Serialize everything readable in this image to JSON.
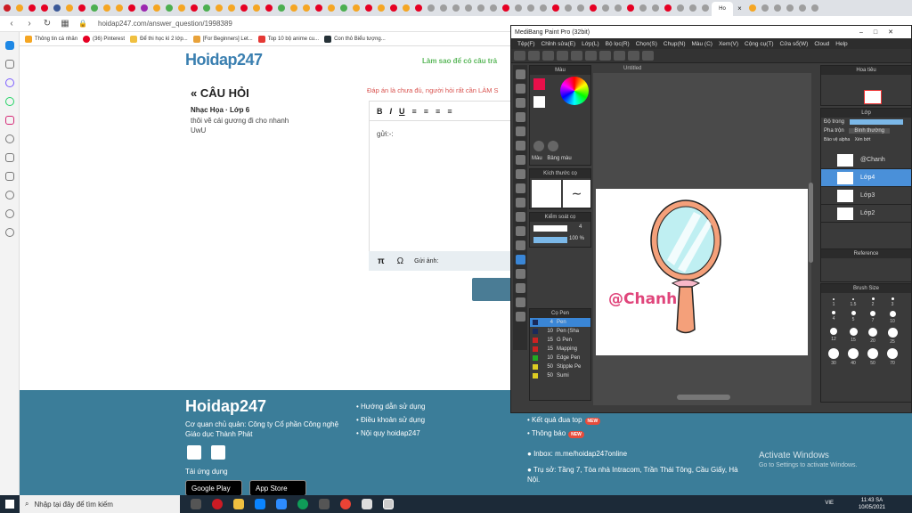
{
  "browser": {
    "url": "hoidap247.com/answer_question/1998389",
    "bookmarks": [
      "Thông tin cá nhân",
      "(36) Pinterest",
      "Để thi học kì 2 lớp...",
      "[For Beginners] Let...",
      "Top 10 bộ anime cu...",
      "Con thỏ Biểu tượng..."
    ],
    "active_tab": "Ho"
  },
  "page": {
    "logo": "Hoidap247",
    "how_ask": "Làm sao để có câu trả",
    "question_heading": "« CÂU HỎI",
    "subject": "Nhạc Họa · Lớp 6",
    "question_lines": [
      "thôi vẽ cái gương đi cho nhanh",
      "UwU"
    ],
    "warning": "Đáp án là chưa đủ, người hỏi rất cần LÀM S",
    "editor_text": "gửi:-:",
    "send_photo": "Gửi ảnh:"
  },
  "footer": {
    "logo": "Hoidap247",
    "company": "Cơ quan chủ quản: Công ty Cổ phần Công nghệ Giáo dục Thành Phát",
    "app_download": "Tải ứng dụng",
    "google_play": "Google Play",
    "app_store": "App Store",
    "links": [
      "Hướng dẫn sử dụng",
      "Điều khoản sử dụng",
      "Nội quy hoidap247"
    ],
    "results": "Kết quả đua top",
    "notice": "Thông báo",
    "new_badge": "NEW",
    "inbox": "Inbox: m.me/hoidap247online",
    "address": "Trụ sở: Tầng 7, Tòa nhà Intracom, Trần Thái Tông, Cầu Giấy, Hà Nội."
  },
  "windows": {
    "activate": "Activate Windows",
    "activate_sub": "Go to Settings to activate Windows.",
    "search_placeholder": "Nhập tại đây để tìm kiếm",
    "time": "11:43 SA",
    "date": "10/05/2021",
    "lang": "VIE"
  },
  "medibang": {
    "title": "MediBang Paint Pro (32bit)",
    "menu": [
      "Tệp(F)",
      "Chỉnh sửa(E)",
      "Lớp(L)",
      "Bộ lọc(R)",
      "Chọn(S)",
      "Chụp(N)",
      "Màu (C)",
      "Xem(V)",
      "Cộng cụ(T)",
      "Cửa sổ(W)",
      "Cloud",
      "Help"
    ],
    "panel_color": "Màu",
    "color_tabs": [
      "Màu",
      "Bảng màu"
    ],
    "panel_brushsize": "Kích thước cọ",
    "panel_brushcontrol": "Kiểm soát cọ",
    "brush_opacity": "100 %",
    "brush_value": "4",
    "panel_pen": "Cọ Pen",
    "pens": [
      {
        "size": "4",
        "name": "Pen",
        "color": "#1a2a5a"
      },
      {
        "size": "10",
        "name": "Pen (Sha",
        "color": "#1a2a5a"
      },
      {
        "size": "15",
        "name": "G Pen",
        "color": "#cc2222"
      },
      {
        "size": "15",
        "name": "Mapping",
        "color": "#cc2222"
      },
      {
        "size": "10",
        "name": "Edge Pen",
        "color": "#22aa22"
      },
      {
        "size": "50",
        "name": "Stipple Pe",
        "color": "#ddcc22"
      },
      {
        "size": "50",
        "name": "Sumi",
        "color": "#ddcc22"
      }
    ],
    "canvas_tab": "Untitled",
    "watermark": "@Chanh",
    "panel_navigator": "Hoa tiêu",
    "panel_layer": "Lớp",
    "opacity_label": "Độ trong",
    "blend_label": "Pha trộn",
    "blend_value": "Bình thường",
    "protect_alpha": "Bảo vệ alpha",
    "clip": "Xén bớt",
    "layers": [
      "@Chanh",
      "Lớp4",
      "Lớp3",
      "Lớp2"
    ],
    "panel_reference": "Reference",
    "panel_brushsizes": "Brush Size",
    "brush_sizes": [
      "1",
      "1.5",
      "2",
      "3",
      "4",
      "5",
      "7",
      "10",
      "12",
      "15",
      "20",
      "25",
      "30",
      "40",
      "50",
      "70"
    ]
  },
  "colors": {
    "accent_blue": "#3b7d99",
    "medibang_select": "#4a90d9",
    "watermark": "#e0457b"
  }
}
